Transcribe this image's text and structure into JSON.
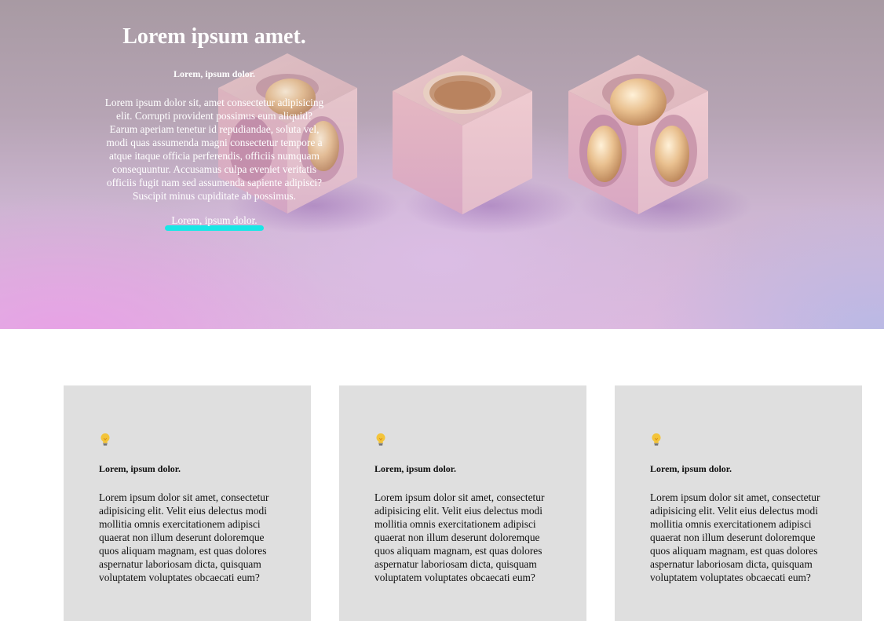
{
  "hero": {
    "title": "Lorem ipsum amet.",
    "subtitle": "Lorem, ipsum dolor.",
    "text": "Lorem ipsum dolor sit, amet consectetur adipisicing elit. Corrupti provident possimus eum aliquid? Earum aperiam tenetur id repudiandae, soluta vel, modi quas assumenda magni consectetur tempore a atque itaque officia perferendis, officiis numquam consequuntur. Accusamus culpa eveniet veritatis officiis fugit nam sed assumenda sapiente adipisci? Suscipit minus cupiditate ab possimus.",
    "button_label": "Lorem, ipsum dolor.",
    "accent_color": "#19e6e6"
  },
  "cards": [
    {
      "icon": "lightbulb-icon",
      "title": "Lorem, ipsum dolor.",
      "text": "Lorem ipsum dolor sit amet, consectetur adipisicing elit. Velit eius delectus modi mollitia omnis exercitationem adipisci quaerat non illum deserunt doloremque quos aliquam magnam, est quas dolores aspernatur laboriosam dicta, quisquam voluptatem voluptates obcaecati eum?"
    },
    {
      "icon": "lightbulb-icon",
      "title": "Lorem, ipsum dolor.",
      "text": "Lorem ipsum dolor sit amet, consectetur adipisicing elit. Velit eius delectus modi mollitia omnis exercitationem adipisci quaerat non illum deserunt doloremque quos aliquam magnam, est quas dolores aspernatur laboriosam dicta, quisquam voluptatem voluptates obcaecati eum?"
    },
    {
      "icon": "lightbulb-icon",
      "title": "Lorem, ipsum dolor.",
      "text": "Lorem ipsum dolor sit amet, consectetur adipisicing elit. Velit eius delectus modi mollitia omnis exercitationem adipisci quaerat non illum deserunt doloremque quos aliquam magnam, est quas dolores aspernatur laboriosam dicta, quisquam voluptatem voluptates obcaecati eum?"
    }
  ]
}
